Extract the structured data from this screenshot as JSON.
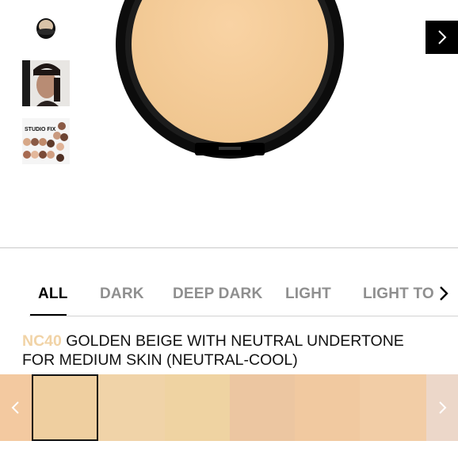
{
  "gallery": {
    "thumbnails": [
      "product-compact",
      "model-portrait",
      "studio-fix-collage"
    ],
    "collage_text": "STUDIO FIX",
    "next_icon": "chevron-right-icon"
  },
  "filter_tabs": {
    "items": [
      {
        "label": "ALL",
        "active": true
      },
      {
        "label": "DARK",
        "active": false
      },
      {
        "label": "DEEP DARK",
        "active": false
      },
      {
        "label": "LIGHT",
        "active": false
      },
      {
        "label": "LIGHT TO",
        "active": false
      }
    ],
    "more_icon": "chevron-right-icon"
  },
  "shade": {
    "code": "NC40",
    "description_line1": "GOLDEN BEIGE WITH NEUTRAL UNDERTONE",
    "description_line2": "FOR MEDIUM SKIN (NEUTRAL-COOL)",
    "code_color": "#f1d3a6"
  },
  "swatches": {
    "colors": [
      "#f3c9a0",
      "#efcfa0",
      "#f0d3a8",
      "#efd3a2",
      "#ecc6a1",
      "#f1c9a0",
      "#f2cda6",
      "#ecd7c9"
    ],
    "selected_index": 1,
    "prev_icon": "chevron-left-icon",
    "next_icon": "chevron-right-icon"
  }
}
